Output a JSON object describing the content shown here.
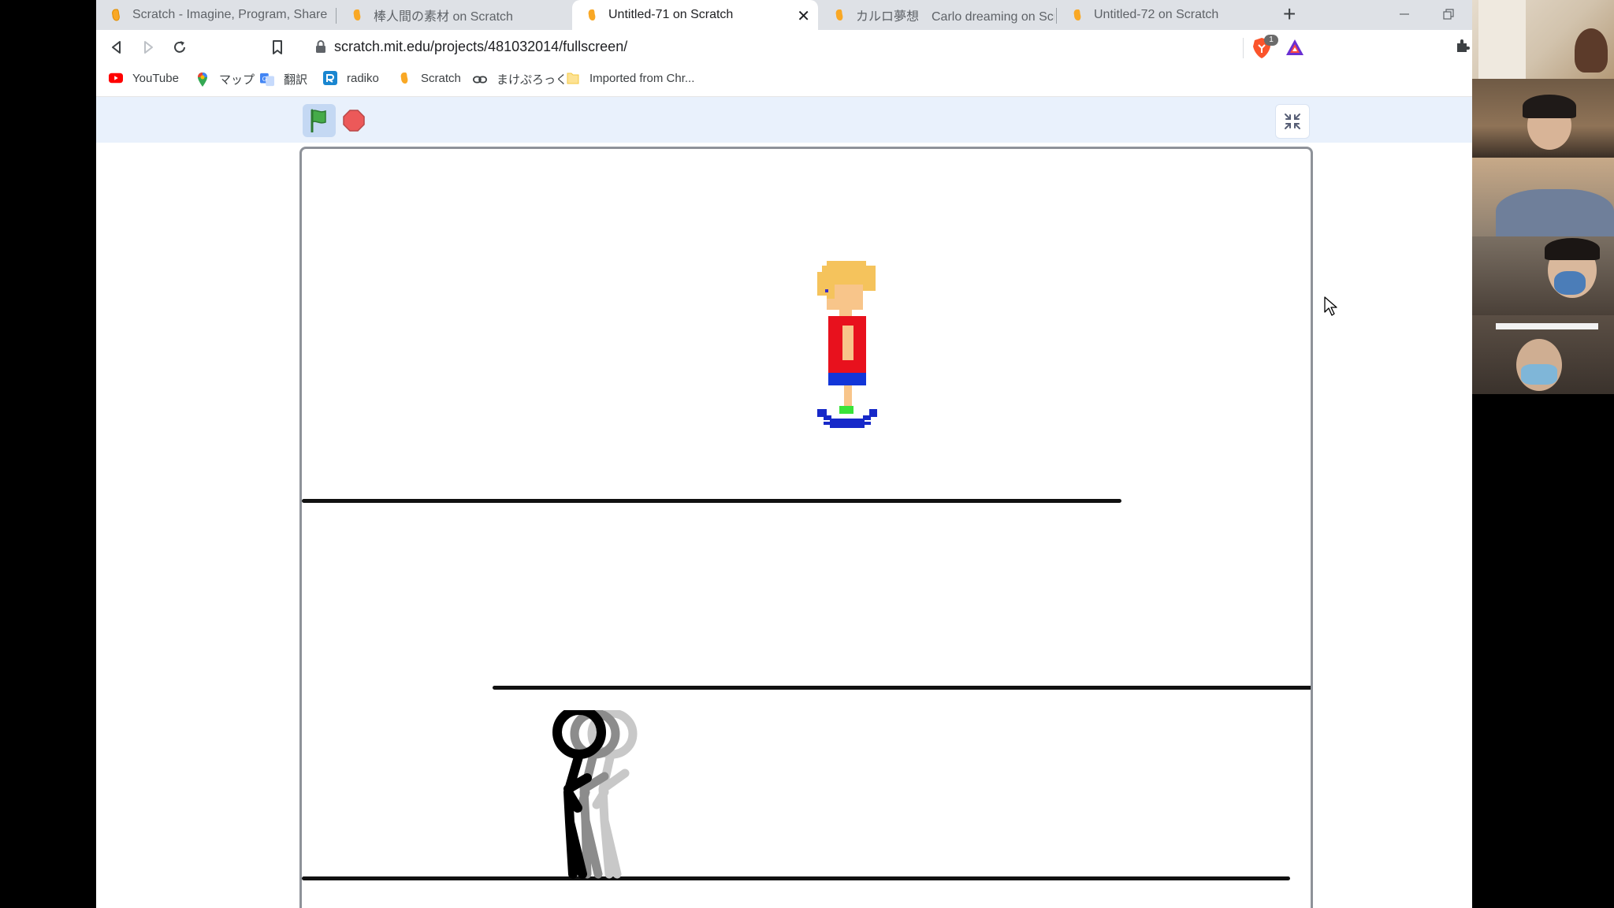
{
  "browser": {
    "tabs": [
      {
        "title": "Scratch - Imagine, Program, Share",
        "active": false
      },
      {
        "title": "棒人間の素材 on Scratch",
        "active": false
      },
      {
        "title": "Untitled-71 on Scratch",
        "active": true
      },
      {
        "title": "カルロ夢想　Carlo dreaming on Scratch",
        "active": false
      },
      {
        "title": "Untitled-72 on Scratch",
        "active": false
      }
    ],
    "tab_close": "✕",
    "new_tab": "+",
    "url": "scratch.mit.edu/projects/481032014/fullscreen/",
    "brave_badge_count": "1",
    "bookmarks": [
      {
        "label": "YouTube",
        "icon": "youtube-icon"
      },
      {
        "label": "マップ",
        "icon": "maps-pin-icon"
      },
      {
        "label": "翻訳",
        "icon": "translate-icon"
      },
      {
        "label": "radiko",
        "icon": "radiko-icon"
      },
      {
        "label": "Scratch",
        "icon": "scratch-icon"
      },
      {
        "label": "まけぷろっく",
        "icon": "link-icon"
      },
      {
        "label": "Imported from Chr...",
        "icon": "folder-icon"
      }
    ]
  },
  "scratch": {
    "controls": [
      "green-flag",
      "stop-sign",
      "exit-fullscreen"
    ],
    "stage": {
      "sprites": [
        "pixel-boy-on-hoverboard",
        "stick-figure-walking"
      ],
      "platforms": 3
    }
  },
  "colors": {
    "tabstrip": "#dee1e6",
    "controls_bar": "#e9f1fc",
    "flag_green": "#3ea34f",
    "stop_red": "#e94b4b",
    "hair": "#f5c35c",
    "shirt": "#e8111d",
    "shorts": "#1236d8"
  },
  "video_call": {
    "participants": 5
  }
}
